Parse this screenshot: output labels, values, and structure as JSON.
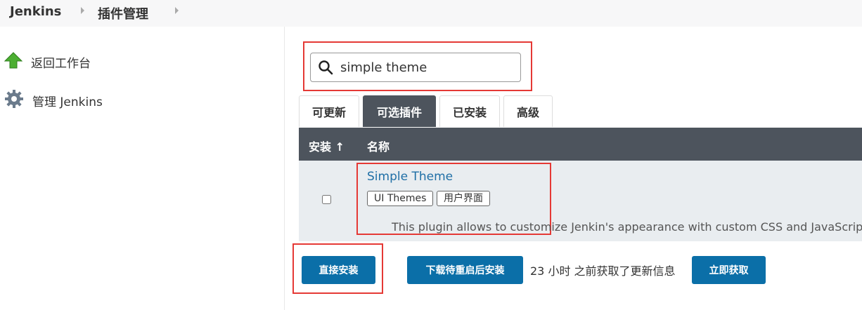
{
  "breadcrumb": [
    "Jenkins",
    "插件管理"
  ],
  "sidebar": {
    "items": [
      {
        "label": "返回工作台",
        "icon": "arrow-up-icon"
      },
      {
        "label": "管理 Jenkins",
        "icon": "gear-icon"
      }
    ]
  },
  "search": {
    "value": "simple theme",
    "icon": "search-icon"
  },
  "tabs": [
    {
      "label": "可更新",
      "active": false
    },
    {
      "label": "可选插件",
      "active": true
    },
    {
      "label": "已安装",
      "active": false
    },
    {
      "label": "高级",
      "active": false
    }
  ],
  "table": {
    "columns": [
      "安装 ↑",
      "名称"
    ],
    "rows": [
      {
        "name": "Simple Theme",
        "tags": [
          "UI Themes",
          "用户界面"
        ],
        "description": "This plugin allows to customize Jenkin's appearance with custom CSS and JavaScript. It",
        "checked": false
      }
    ]
  },
  "actions": {
    "install_now": "直接安装",
    "install_after_restart": "下载待重启后安装",
    "updated_info": "23 小时 之前获取了更新信息",
    "fetch_now": "立即获取"
  },
  "colors": {
    "accent": "#0b6fa8",
    "header_bg": "#4d545d",
    "highlight": "#e53935",
    "link": "#1f6fa6"
  }
}
